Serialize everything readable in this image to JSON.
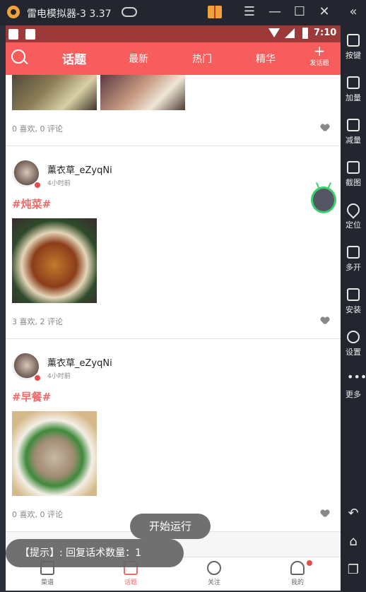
{
  "emulator": {
    "title": "雷电模拟器-3 3.37",
    "controls": {
      "menu": "☰",
      "minimize": "—",
      "maximize": "☐",
      "close": "✕",
      "collapse": "«"
    },
    "sidebar": [
      {
        "label": "按键",
        "icon": "keyboard-icon"
      },
      {
        "label": "加量",
        "icon": "volume-up-icon"
      },
      {
        "label": "减量",
        "icon": "volume-down-icon"
      },
      {
        "label": "截图",
        "icon": "scissors-icon"
      },
      {
        "label": "定位",
        "icon": "location-pin-icon"
      },
      {
        "label": "多开",
        "icon": "multi-window-icon"
      },
      {
        "label": "安装",
        "icon": "apk-install-icon"
      },
      {
        "label": "设置",
        "icon": "gear-icon"
      },
      {
        "label": "更多",
        "icon": "more-dots-icon"
      }
    ],
    "bottom_controls": {
      "back": "↶",
      "home": "⌂",
      "recent": "❐"
    }
  },
  "android": {
    "status_bar": {
      "time": "7:10"
    },
    "app_bar": {
      "tabs": [
        {
          "label": "话题",
          "active": true
        },
        {
          "label": "最新"
        },
        {
          "label": "热门"
        },
        {
          "label": "精华"
        }
      ],
      "post_button": {
        "plus": "+",
        "label": "发话题"
      }
    },
    "feed": {
      "partial_post": {
        "stats": "0 喜欢, 0 评论"
      },
      "posts": [
        {
          "username": "薰衣草_eZyqNi",
          "time": "4小时前",
          "tag": "#炖菜#",
          "stats": "3 喜欢, 2 评论"
        },
        {
          "username": "薰衣草_eZyqNi",
          "time": "4小时前",
          "tag": "#早餐#",
          "stats": "0 喜欢, 0 评论"
        }
      ]
    },
    "bottom_nav": [
      {
        "label": "菜谱"
      },
      {
        "label": "话题",
        "active": true
      },
      {
        "label": "关注"
      },
      {
        "label": "我的"
      }
    ],
    "toasts": {
      "start": "开始运行",
      "hint": "【提示】: 回复话术数量：1"
    }
  },
  "colors": {
    "accent": "#f85d5d",
    "tag": "#f06a6a",
    "status_bar": "#9c3a3a"
  }
}
